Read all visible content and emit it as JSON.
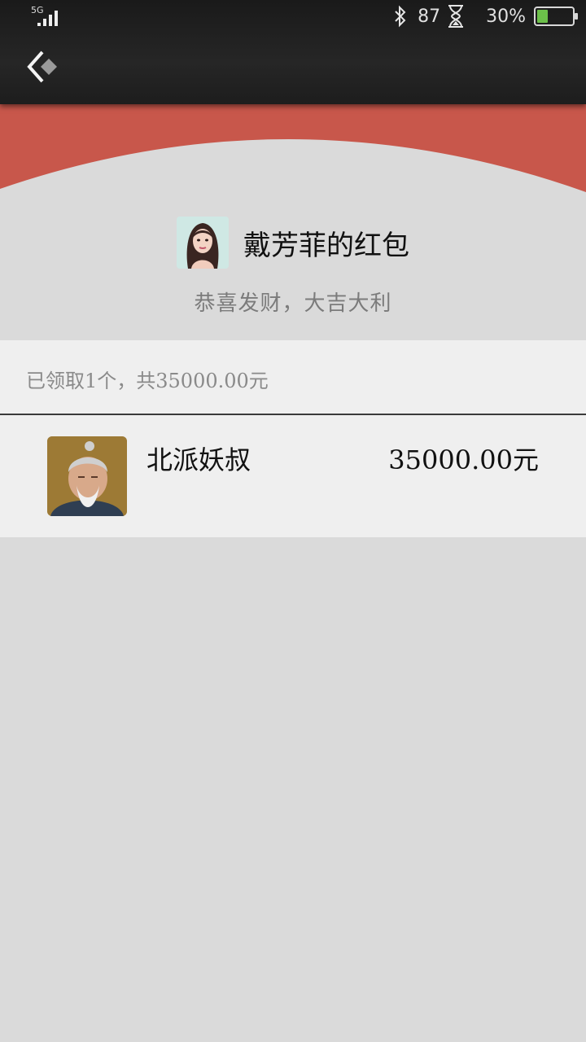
{
  "status_bar": {
    "network": "5G",
    "signal_strength": 4,
    "bluetooth_icon": "bluetooth-icon",
    "number": "87",
    "hourglass_icon": "hourglass-icon",
    "battery_percent": "30%",
    "battery_level": 0.3,
    "battery_color": "#6cc04a"
  },
  "nav": {
    "back_icon": "back-chevron-icon"
  },
  "envelope": {
    "accent": "#c8574b",
    "sender_title": "戴芳菲的红包",
    "blessing": "恭喜发财，大吉大利"
  },
  "summary": {
    "text": "已领取1个，共35000.00元"
  },
  "records": [
    {
      "name": "北派妖叔",
      "amount": "35000.00元"
    }
  ]
}
